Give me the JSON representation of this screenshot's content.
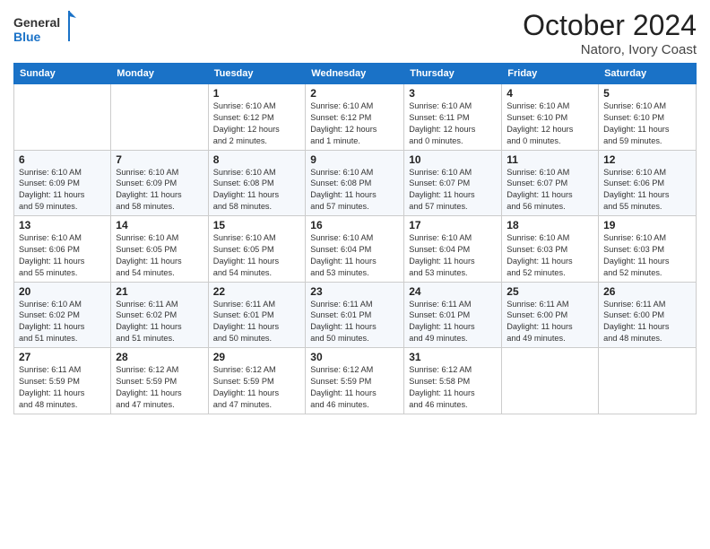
{
  "logo": {
    "general": "General",
    "blue": "Blue"
  },
  "header": {
    "month": "October 2024",
    "location": "Natoro, Ivory Coast"
  },
  "weekdays": [
    "Sunday",
    "Monday",
    "Tuesday",
    "Wednesday",
    "Thursday",
    "Friday",
    "Saturday"
  ],
  "weeks": [
    [
      {
        "day": "",
        "info": ""
      },
      {
        "day": "",
        "info": ""
      },
      {
        "day": "1",
        "info": "Sunrise: 6:10 AM\nSunset: 6:12 PM\nDaylight: 12 hours\nand 2 minutes."
      },
      {
        "day": "2",
        "info": "Sunrise: 6:10 AM\nSunset: 6:12 PM\nDaylight: 12 hours\nand 1 minute."
      },
      {
        "day": "3",
        "info": "Sunrise: 6:10 AM\nSunset: 6:11 PM\nDaylight: 12 hours\nand 0 minutes."
      },
      {
        "day": "4",
        "info": "Sunrise: 6:10 AM\nSunset: 6:10 PM\nDaylight: 12 hours\nand 0 minutes."
      },
      {
        "day": "5",
        "info": "Sunrise: 6:10 AM\nSunset: 6:10 PM\nDaylight: 11 hours\nand 59 minutes."
      }
    ],
    [
      {
        "day": "6",
        "info": "Sunrise: 6:10 AM\nSunset: 6:09 PM\nDaylight: 11 hours\nand 59 minutes."
      },
      {
        "day": "7",
        "info": "Sunrise: 6:10 AM\nSunset: 6:09 PM\nDaylight: 11 hours\nand 58 minutes."
      },
      {
        "day": "8",
        "info": "Sunrise: 6:10 AM\nSunset: 6:08 PM\nDaylight: 11 hours\nand 58 minutes."
      },
      {
        "day": "9",
        "info": "Sunrise: 6:10 AM\nSunset: 6:08 PM\nDaylight: 11 hours\nand 57 minutes."
      },
      {
        "day": "10",
        "info": "Sunrise: 6:10 AM\nSunset: 6:07 PM\nDaylight: 11 hours\nand 57 minutes."
      },
      {
        "day": "11",
        "info": "Sunrise: 6:10 AM\nSunset: 6:07 PM\nDaylight: 11 hours\nand 56 minutes."
      },
      {
        "day": "12",
        "info": "Sunrise: 6:10 AM\nSunset: 6:06 PM\nDaylight: 11 hours\nand 55 minutes."
      }
    ],
    [
      {
        "day": "13",
        "info": "Sunrise: 6:10 AM\nSunset: 6:06 PM\nDaylight: 11 hours\nand 55 minutes."
      },
      {
        "day": "14",
        "info": "Sunrise: 6:10 AM\nSunset: 6:05 PM\nDaylight: 11 hours\nand 54 minutes."
      },
      {
        "day": "15",
        "info": "Sunrise: 6:10 AM\nSunset: 6:05 PM\nDaylight: 11 hours\nand 54 minutes."
      },
      {
        "day": "16",
        "info": "Sunrise: 6:10 AM\nSunset: 6:04 PM\nDaylight: 11 hours\nand 53 minutes."
      },
      {
        "day": "17",
        "info": "Sunrise: 6:10 AM\nSunset: 6:04 PM\nDaylight: 11 hours\nand 53 minutes."
      },
      {
        "day": "18",
        "info": "Sunrise: 6:10 AM\nSunset: 6:03 PM\nDaylight: 11 hours\nand 52 minutes."
      },
      {
        "day": "19",
        "info": "Sunrise: 6:10 AM\nSunset: 6:03 PM\nDaylight: 11 hours\nand 52 minutes."
      }
    ],
    [
      {
        "day": "20",
        "info": "Sunrise: 6:10 AM\nSunset: 6:02 PM\nDaylight: 11 hours\nand 51 minutes."
      },
      {
        "day": "21",
        "info": "Sunrise: 6:11 AM\nSunset: 6:02 PM\nDaylight: 11 hours\nand 51 minutes."
      },
      {
        "day": "22",
        "info": "Sunrise: 6:11 AM\nSunset: 6:01 PM\nDaylight: 11 hours\nand 50 minutes."
      },
      {
        "day": "23",
        "info": "Sunrise: 6:11 AM\nSunset: 6:01 PM\nDaylight: 11 hours\nand 50 minutes."
      },
      {
        "day": "24",
        "info": "Sunrise: 6:11 AM\nSunset: 6:01 PM\nDaylight: 11 hours\nand 49 minutes."
      },
      {
        "day": "25",
        "info": "Sunrise: 6:11 AM\nSunset: 6:00 PM\nDaylight: 11 hours\nand 49 minutes."
      },
      {
        "day": "26",
        "info": "Sunrise: 6:11 AM\nSunset: 6:00 PM\nDaylight: 11 hours\nand 48 minutes."
      }
    ],
    [
      {
        "day": "27",
        "info": "Sunrise: 6:11 AM\nSunset: 5:59 PM\nDaylight: 11 hours\nand 48 minutes."
      },
      {
        "day": "28",
        "info": "Sunrise: 6:12 AM\nSunset: 5:59 PM\nDaylight: 11 hours\nand 47 minutes."
      },
      {
        "day": "29",
        "info": "Sunrise: 6:12 AM\nSunset: 5:59 PM\nDaylight: 11 hours\nand 47 minutes."
      },
      {
        "day": "30",
        "info": "Sunrise: 6:12 AM\nSunset: 5:59 PM\nDaylight: 11 hours\nand 46 minutes."
      },
      {
        "day": "31",
        "info": "Sunrise: 6:12 AM\nSunset: 5:58 PM\nDaylight: 11 hours\nand 46 minutes."
      },
      {
        "day": "",
        "info": ""
      },
      {
        "day": "",
        "info": ""
      }
    ]
  ]
}
